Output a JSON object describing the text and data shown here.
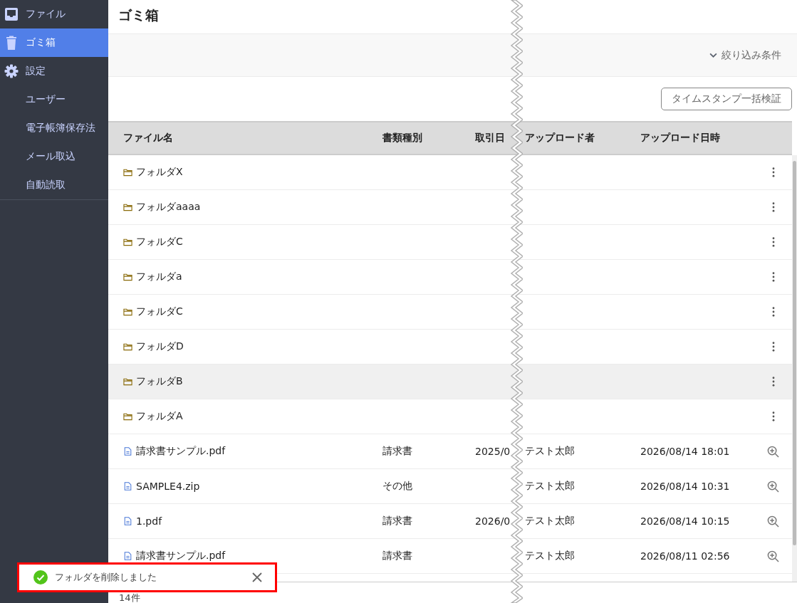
{
  "sidebar": {
    "items": [
      {
        "label": "ファイル",
        "kind": "main",
        "selected": false
      },
      {
        "label": "ゴミ箱",
        "kind": "main",
        "selected": true
      },
      {
        "label": "設定",
        "kind": "main",
        "selected": false
      },
      {
        "label": "ユーザー",
        "kind": "sub",
        "selected": false
      },
      {
        "label": "電子帳簿保存法",
        "kind": "sub",
        "selected": false
      },
      {
        "label": "メール取込",
        "kind": "sub",
        "selected": false
      },
      {
        "label": "自動読取",
        "kind": "sub",
        "selected": false
      }
    ]
  },
  "page_title": "ゴミ箱",
  "filter_toggle": {
    "label": "絞り込み条件",
    "expanded": false
  },
  "verify_button": "タイムスタンプ一括検証",
  "table": {
    "columns": [
      "ファイル名",
      "書類種別",
      "取引日",
      "アップロード者",
      "アップロード日時"
    ],
    "rows": [
      {
        "kind": "folder",
        "name": "フォルダX",
        "highlighted": false
      },
      {
        "kind": "folder",
        "name": "フォルダaaaa",
        "highlighted": false
      },
      {
        "kind": "folder",
        "name": "フォルダC",
        "highlighted": false
      },
      {
        "kind": "folder",
        "name": "フォルダa",
        "highlighted": false
      },
      {
        "kind": "folder",
        "name": "フォルダC",
        "highlighted": false
      },
      {
        "kind": "folder",
        "name": "フォルダD",
        "highlighted": false
      },
      {
        "kind": "folder",
        "name": "フォルダB",
        "highlighted": true
      },
      {
        "kind": "folder",
        "name": "フォルダA",
        "highlighted": false
      },
      {
        "kind": "file",
        "name": "請求書サンプル.pdf",
        "type": "請求書",
        "date": "2025/0",
        "uploader": "テスト太郎",
        "uploaded": "2026/08/14 18:01",
        "highlighted": false
      },
      {
        "kind": "file",
        "name": "SAMPLE4.zip",
        "type": "その他",
        "uploader": "テスト太郎",
        "uploaded": "2026/08/14 10:31",
        "highlighted": false
      },
      {
        "kind": "file",
        "name": "1.pdf",
        "type": "請求書",
        "date": "2026/0",
        "uploader": "テスト太郎",
        "uploaded": "2026/08/14 10:15",
        "highlighted": false
      },
      {
        "kind": "file",
        "name": "請求書サンプル.pdf",
        "type": "請求書",
        "uploader": "テスト太郎",
        "uploaded": "2026/08/11 02:56",
        "highlighted": false
      }
    ]
  },
  "count": "14件",
  "toast": {
    "message": "フォルダを削除しました",
    "kind": "success"
  }
}
